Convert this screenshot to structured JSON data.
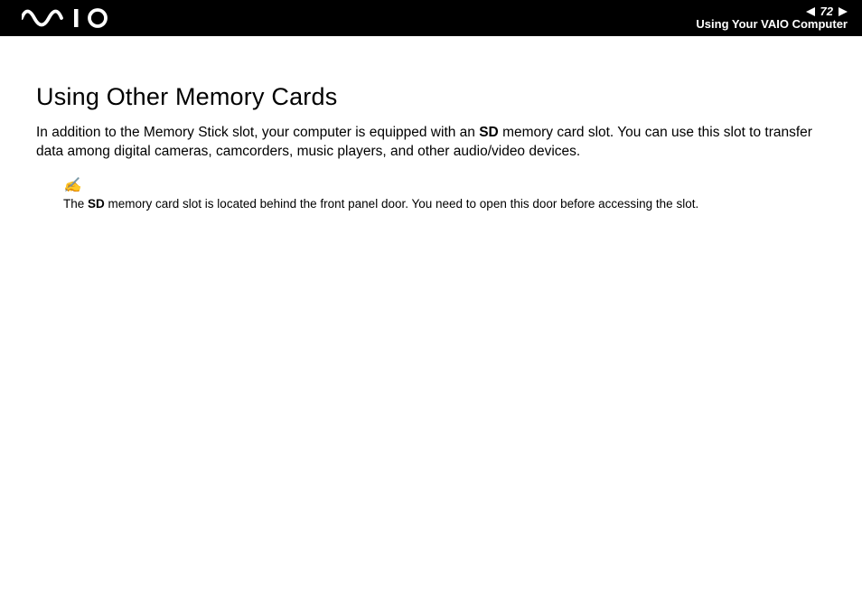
{
  "header": {
    "page_number": "72",
    "section": "Using Your VAIO Computer"
  },
  "main": {
    "title": "Using Other Memory Cards",
    "paragraph_pre": "In addition to the Memory Stick slot, your computer is equipped with an ",
    "paragraph_bold": "SD",
    "paragraph_post": " memory card slot. You can use this slot to transfer data among digital cameras, camcorders, music players, and other audio/video devices.",
    "note_icon": "✍",
    "note_pre": "The ",
    "note_bold": "SD",
    "note_post": " memory card slot is located behind the front panel door. You need to open this door before accessing the slot."
  }
}
